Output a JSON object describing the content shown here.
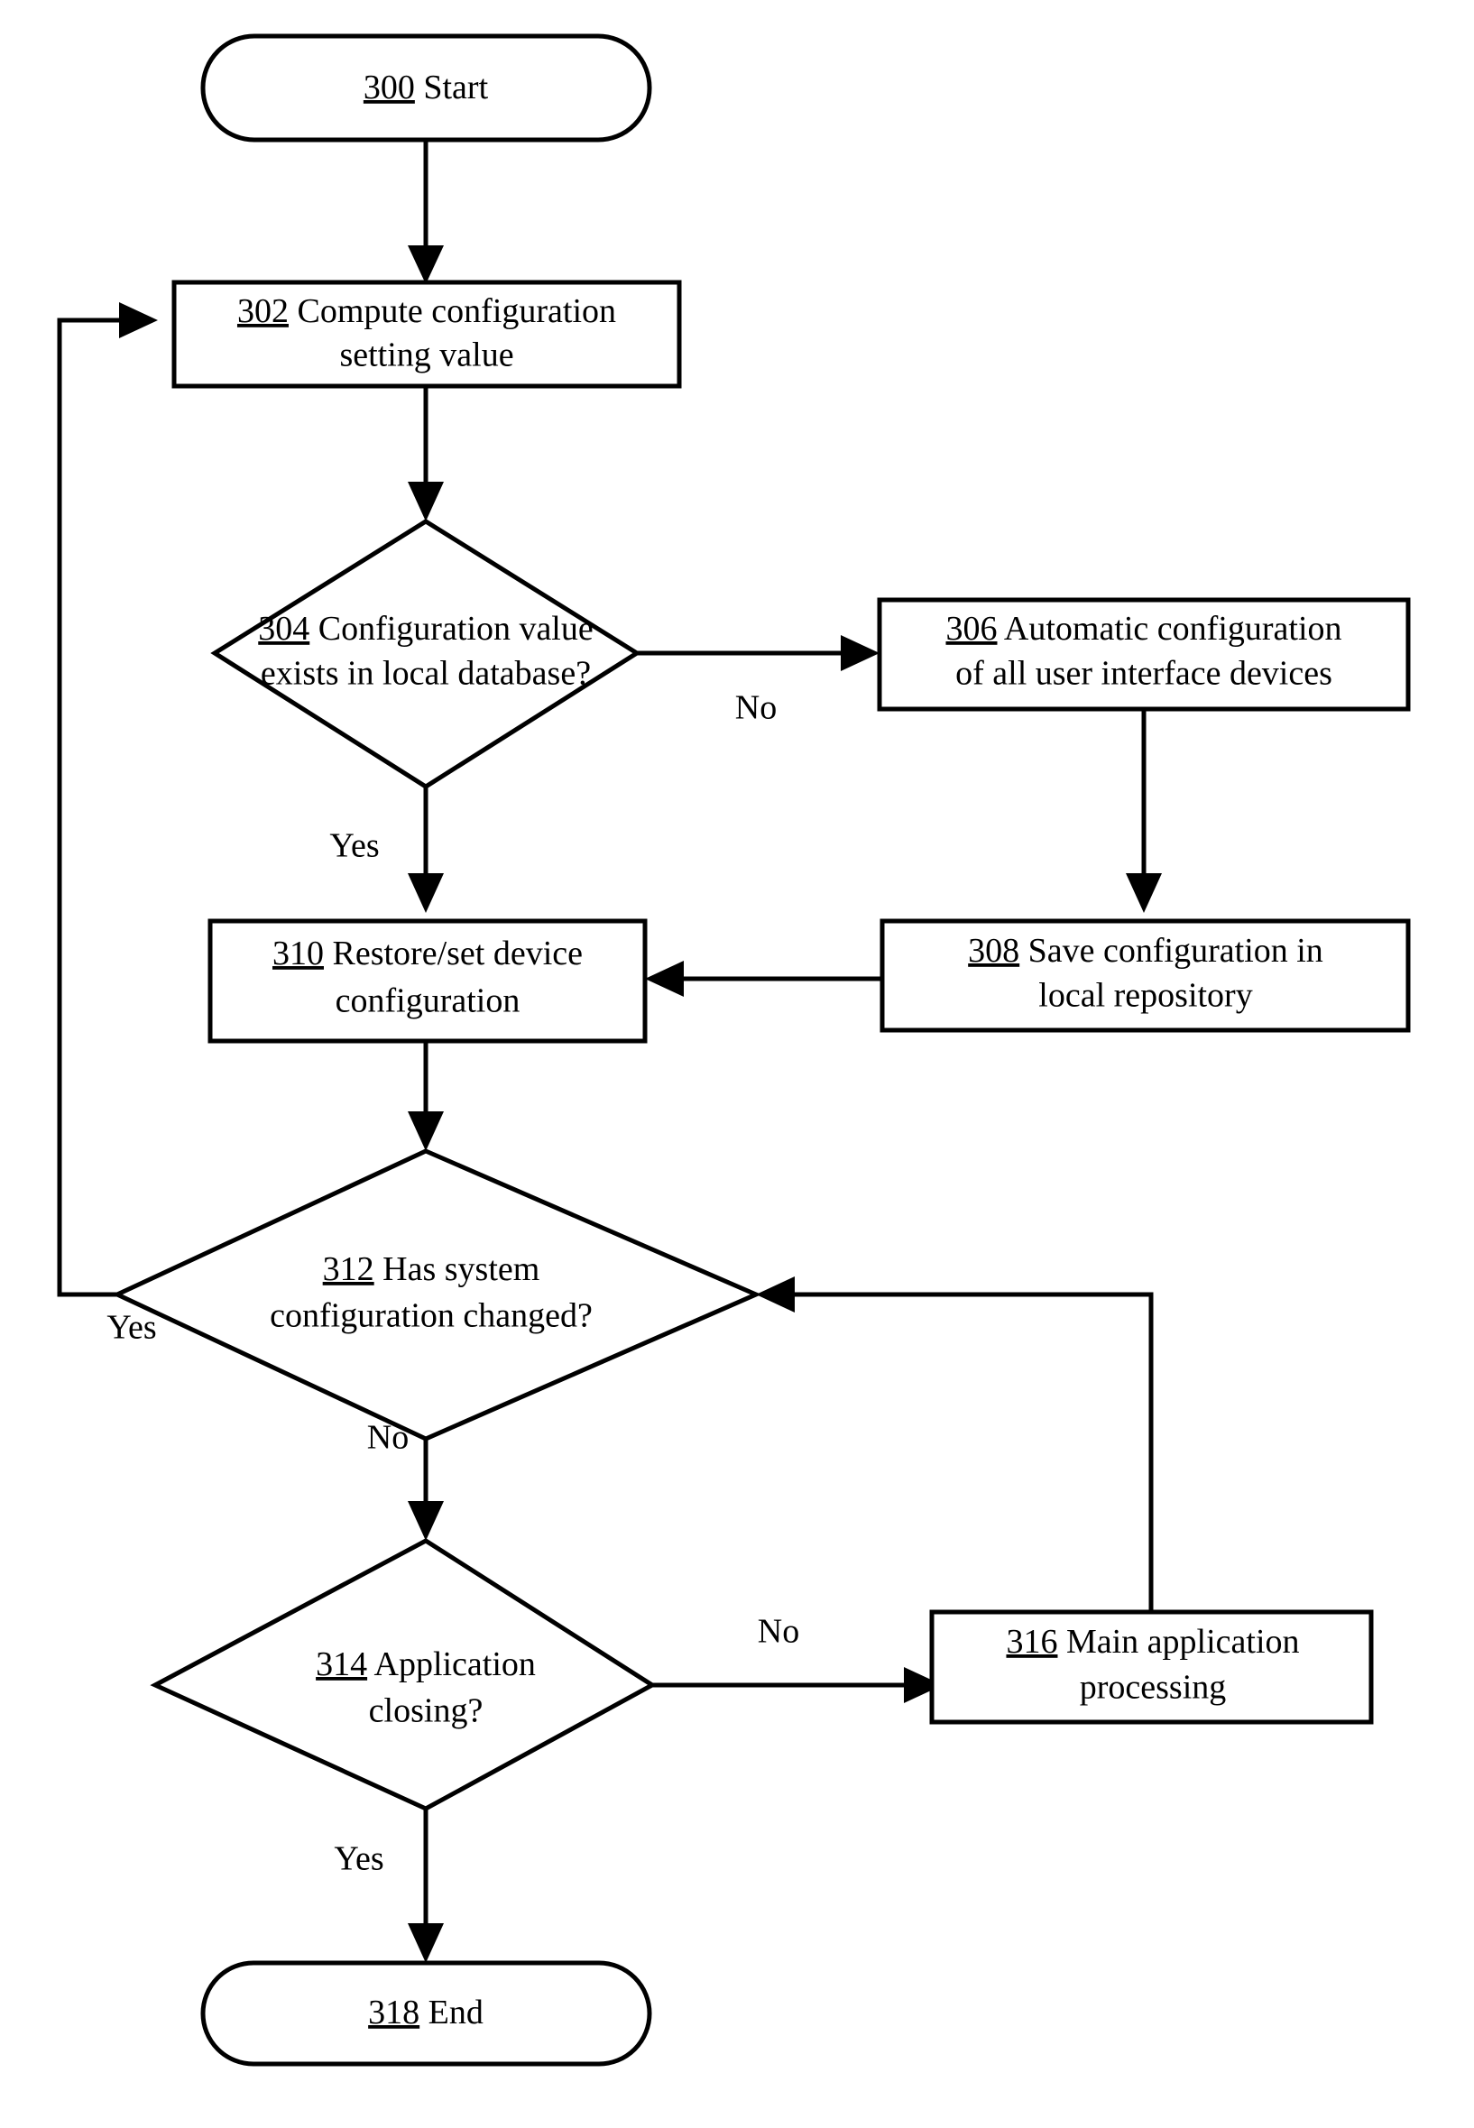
{
  "figure": {
    "type": "flowchart",
    "title": "",
    "background_color": "#ffffff",
    "line_color": "#000000",
    "text_color": "#000000"
  },
  "nodes": {
    "n300": {
      "ref": "300",
      "shape": "terminator",
      "lines": [
        "Start"
      ],
      "text": "300 Start"
    },
    "n302": {
      "ref": "302",
      "shape": "process",
      "lines": [
        "Compute configuration",
        "setting value"
      ],
      "text": "302 Compute configuration setting value"
    },
    "n304": {
      "ref": "304",
      "shape": "decision",
      "lines": [
        "Configuration value",
        "exists in local database?"
      ],
      "text": "304 Configuration value exists in local database?"
    },
    "n306": {
      "ref": "306",
      "shape": "process",
      "lines": [
        "Automatic configuration",
        "of all user interface devices"
      ],
      "text": "306 Automatic configuration of all user interface devices"
    },
    "n308": {
      "ref": "308",
      "shape": "process",
      "lines": [
        "Save configuration in",
        "local repository"
      ],
      "text": "308 Save configuration in local repository"
    },
    "n310": {
      "ref": "310",
      "shape": "process",
      "lines": [
        "Restore/set device",
        "configuration"
      ],
      "text": "310 Restore/set device configuration"
    },
    "n312": {
      "ref": "312",
      "shape": "decision",
      "lines": [
        "Has system",
        "configuration changed?"
      ],
      "text": "312 Has system configuration changed?"
    },
    "n314": {
      "ref": "314",
      "shape": "decision",
      "lines": [
        "Application",
        "closing?"
      ],
      "text": "314 Application closing?"
    },
    "n316": {
      "ref": "316",
      "shape": "process",
      "lines": [
        "Main application",
        "processing"
      ],
      "text": "316 Main application processing"
    },
    "n318": {
      "ref": "318",
      "shape": "terminator",
      "lines": [
        "End"
      ],
      "text": "318 End"
    }
  },
  "edge_labels": {
    "e304_no": "No",
    "e304_yes": "Yes",
    "e312_yes": "Yes",
    "e312_no": "No",
    "e314_no": "No",
    "e314_yes": "Yes"
  },
  "edges": [
    {
      "from": "300",
      "to": "302",
      "label": ""
    },
    {
      "from": "302",
      "to": "304",
      "label": ""
    },
    {
      "from": "304",
      "to": "306",
      "label": "No"
    },
    {
      "from": "304",
      "to": "310",
      "label": "Yes"
    },
    {
      "from": "306",
      "to": "308",
      "label": ""
    },
    {
      "from": "308",
      "to": "310",
      "label": ""
    },
    {
      "from": "310",
      "to": "312",
      "label": ""
    },
    {
      "from": "312",
      "to": "302",
      "label": "Yes"
    },
    {
      "from": "312",
      "to": "314",
      "label": "No"
    },
    {
      "from": "314",
      "to": "316",
      "label": "No"
    },
    {
      "from": "314",
      "to": "318",
      "label": "Yes"
    },
    {
      "from": "316",
      "to": "312",
      "label": ""
    }
  ]
}
